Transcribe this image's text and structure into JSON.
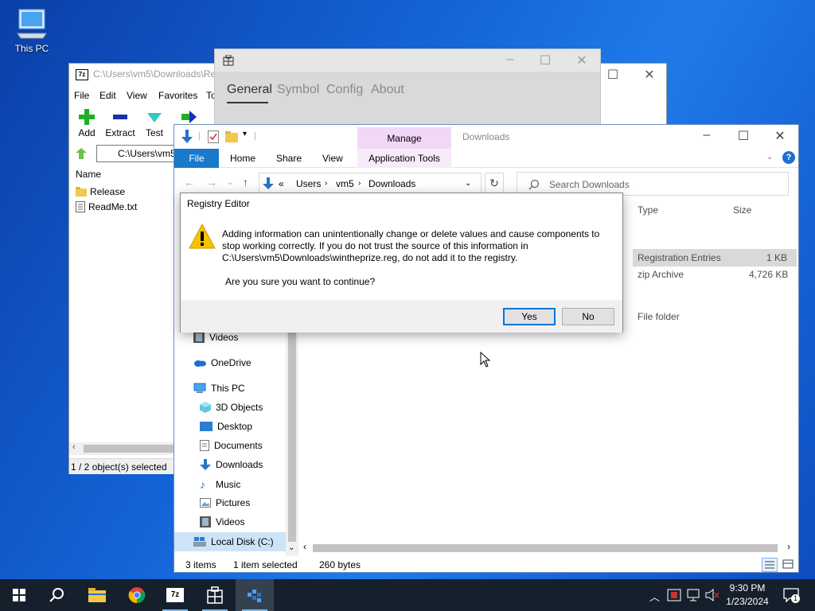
{
  "desktop": {
    "this_pc_label": "This PC"
  },
  "zip": {
    "title": "C:\\Users\\vm5\\Downloads\\Re",
    "menu": [
      "File",
      "Edit",
      "View",
      "Favorites",
      "To"
    ],
    "tools": [
      "Add",
      "Extract",
      "Test",
      ""
    ],
    "address": "C:\\Users\\vm5\\",
    "column_name": "Name",
    "items": [
      "Release",
      "ReadMe.txt"
    ],
    "status": "1 / 2 object(s) selected"
  },
  "settings": {
    "tabs": [
      "General",
      "Symbol",
      "Config",
      "About"
    ]
  },
  "explorer": {
    "title": "Downloads",
    "manage": "Manage",
    "ribbon": {
      "file": "File",
      "home": "Home",
      "share": "Share",
      "view": "View",
      "app_tools": "Application Tools"
    },
    "breadcrumb": [
      "«",
      "Users",
      "vm5",
      "Downloads"
    ],
    "search_placeholder": "Search Downloads",
    "columns": {
      "type": "Type",
      "size": "Size"
    },
    "rows": [
      {
        "type": "Registration Entries",
        "size": "1 KB"
      },
      {
        "type": "zip Archive",
        "size": "4,726 KB"
      },
      {
        "type": "File folder",
        "size": ""
      }
    ],
    "nav": [
      "Videos",
      "OneDrive",
      "This PC",
      "3D Objects",
      "Desktop",
      "Documents",
      "Downloads",
      "Music",
      "Pictures",
      "Videos",
      "Local Disk (C:)"
    ],
    "status": {
      "items": "3 items",
      "selected": "1 item selected",
      "bytes": "260 bytes"
    }
  },
  "dialog": {
    "title": "Registry Editor",
    "message": "Adding information can unintentionally change or delete values and cause components to stop working correctly. If you do not trust the source of this information in C:\\Users\\vm5\\Downloads\\wintheprize.reg, do not add it to the registry.",
    "question": "Are you sure you want to continue?",
    "yes": "Yes",
    "no": "No"
  },
  "taskbar": {
    "time": "9:30 PM",
    "date": "1/23/2024",
    "notification_count": "1"
  },
  "colors": {
    "accent": "#0078d7",
    "taskbar": "#16202c",
    "manage_tab": "#f1d8f7"
  }
}
